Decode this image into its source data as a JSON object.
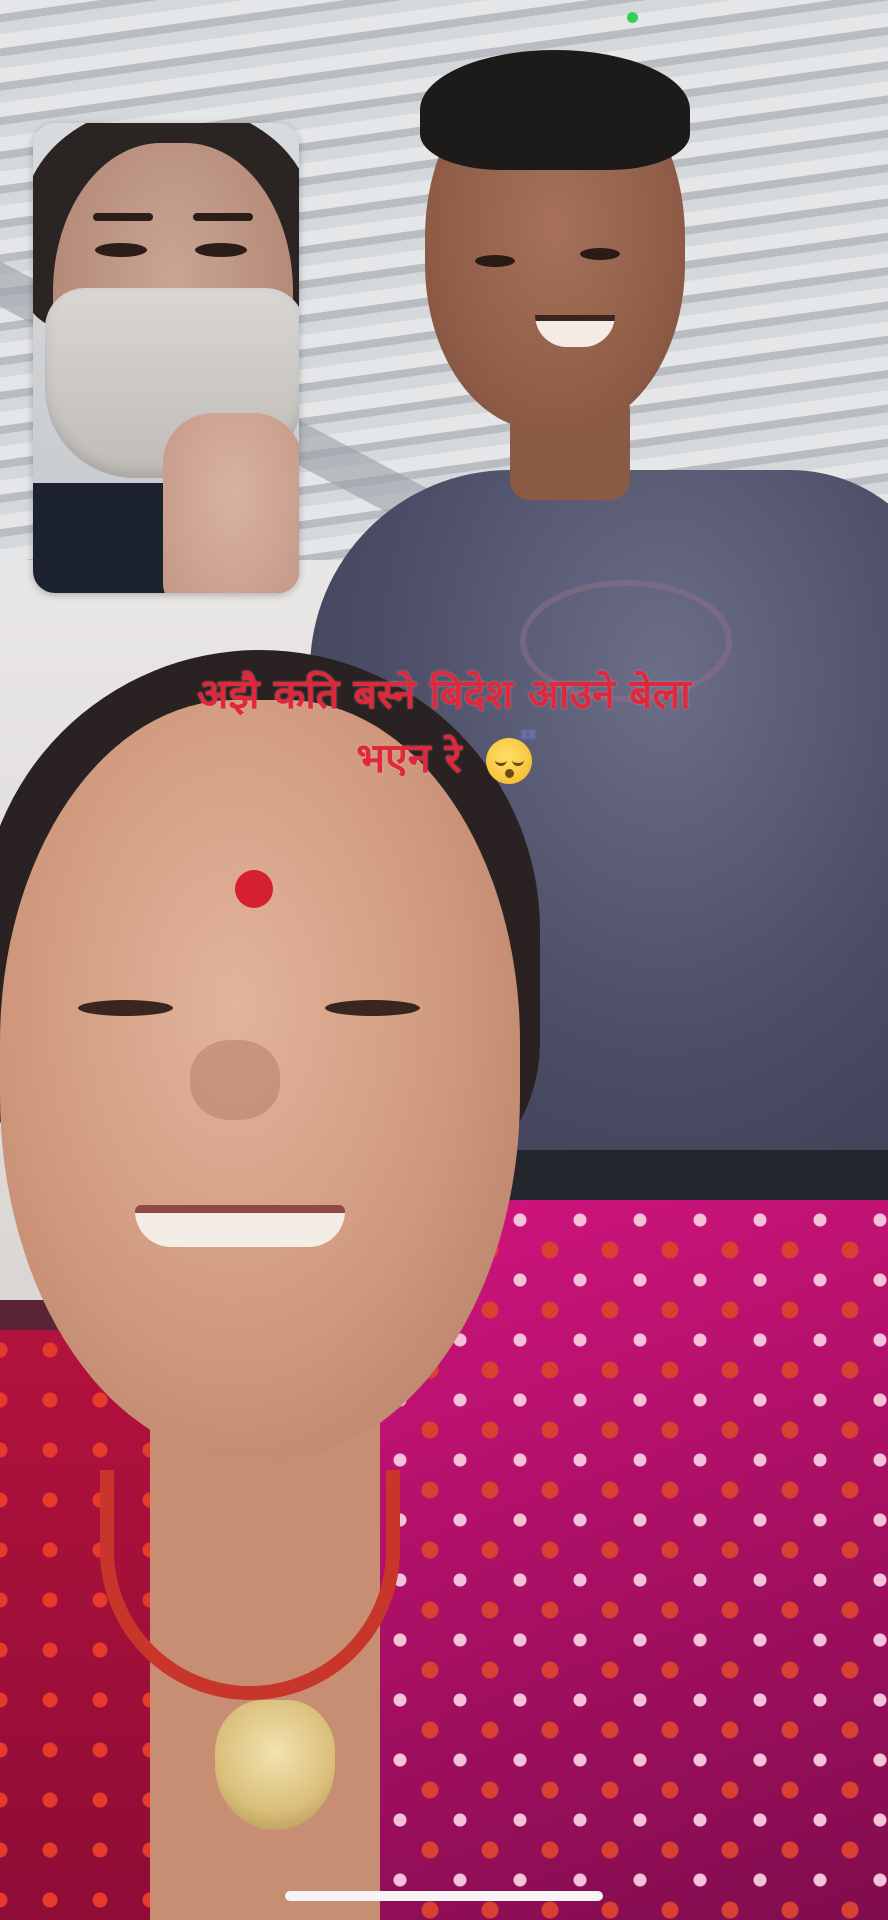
{
  "call": {
    "caption_line1": "अझै कति बस्ने बिदेश  आउने बेला",
    "caption_line2": "भएन रे",
    "caption_emoji": "sleeping-face-icon",
    "caption_emoji_zzz": "zz",
    "caption_color": "#e0283c"
  },
  "indicators": {
    "camera_in_use_color": "#2fd158",
    "home_indicator_color": "#f5f5f5"
  },
  "icons": {
    "camera_in_use": "green-dot-icon",
    "home_bar": "home-indicator-bar"
  }
}
